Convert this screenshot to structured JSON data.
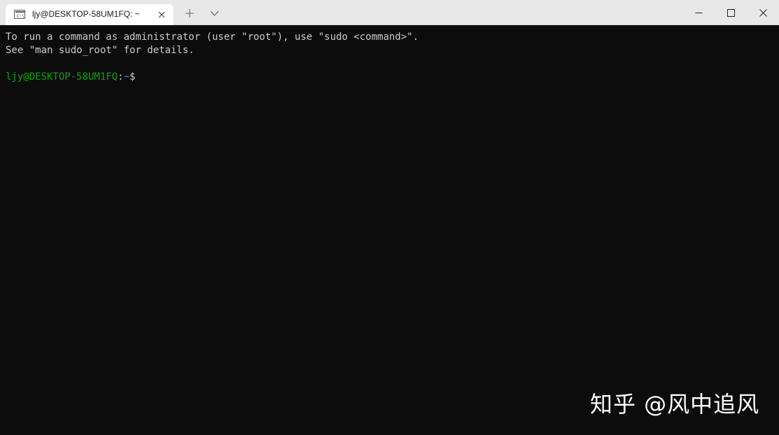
{
  "tab": {
    "title": "ljy@DESKTOP-58UM1FQ: ~",
    "icon": "terminal-icon"
  },
  "toolbar": {
    "new_tab_icon": "plus-icon",
    "dropdown_icon": "chevron-down-icon"
  },
  "window_controls": {
    "minimize_icon": "minimize-icon",
    "maximize_icon": "maximize-icon",
    "close_icon": "close-icon"
  },
  "terminal": {
    "lines": [
      "To run a command as administrator (user \"root\"), use \"sudo <command>\".",
      "See \"man sudo_root\" for details.",
      ""
    ],
    "prompt": {
      "user_host": "ljy@DESKTOP-58UM1FQ",
      "colon": ":",
      "path": "~",
      "symbol": "$"
    }
  },
  "watermark": {
    "text": "知乎 @风中追风"
  },
  "colors": {
    "background": "#0c0c0c",
    "foreground": "#cccccc",
    "prompt_user": "#13a10e",
    "prompt_path": "#3b78ff",
    "titlebar": "#e8e8e8"
  }
}
